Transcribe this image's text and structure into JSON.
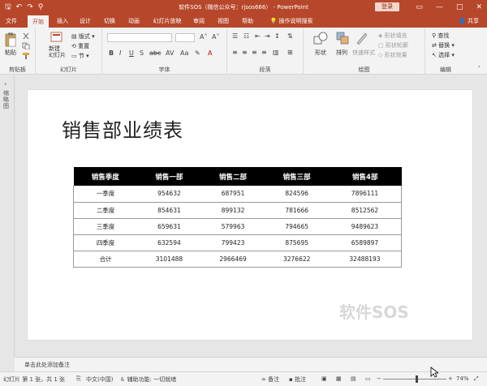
{
  "titlebar": {
    "title": "软件SOS（微信公众号：rjsos666） - PowerPoint",
    "login": "登录",
    "minimize": "—",
    "maximize": "□",
    "close": "✕"
  },
  "tabs": [
    "文件",
    "开始",
    "插入",
    "设计",
    "切换",
    "动画",
    "幻灯片放映",
    "审阅",
    "视图",
    "帮助",
    "操作说明搜索"
  ],
  "share": "共享",
  "ribbon": {
    "clipboard": {
      "label": "剪贴板",
      "paste": "粘贴"
    },
    "slides": {
      "label": "幻灯片",
      "new_slide": "新建\n幻灯片",
      "layout": "版式",
      "reset": "重置",
      "section": "节"
    },
    "font": {
      "label": "字体"
    },
    "paragraph": {
      "label": "段落"
    },
    "drawing": {
      "label": "绘图",
      "shape": "形状",
      "arrange": "排列",
      "quick_styles": "快速样式",
      "fill": "形状填充",
      "outline": "形状轮廓",
      "effects": "形状效果"
    },
    "editing": {
      "label": "编辑",
      "find": "查找",
      "replace": "替换",
      "select": "选择"
    }
  },
  "thumbpane": {
    "label": "缩略图"
  },
  "slide": {
    "title": "销售部业绩表",
    "table": {
      "headers": [
        "销售季度",
        "销售一部",
        "销售二部",
        "销售三部",
        "销售4部"
      ],
      "rows": [
        [
          "一季度",
          "954632",
          "687951",
          "824596",
          "7896111"
        ],
        [
          "二季度",
          "854631",
          "899132",
          "781666",
          "8512562"
        ],
        [
          "三季度",
          "659631",
          "579963",
          "794665",
          "9489623"
        ],
        [
          "四季度",
          "632594",
          "799423",
          "875695",
          "6589897"
        ],
        [
          "合计",
          "3101488",
          "2966469",
          "3276622",
          "32488193"
        ]
      ]
    },
    "watermark": "软件SOS"
  },
  "notes": {
    "placeholder": "单击此处添加备注"
  },
  "statusbar": {
    "slide_info": "幻灯片 第 1 张，共 1 张",
    "language": "中文(中国)",
    "accessibility": "辅助功能: 一切就绪",
    "notes_btn": "备注",
    "comments_btn": "批注",
    "zoom": "74%"
  },
  "colors": {
    "accent": "#b7472a"
  }
}
